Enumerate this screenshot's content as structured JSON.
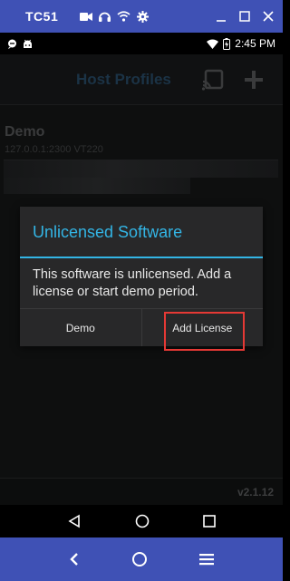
{
  "host": {
    "title": "TC51",
    "status_icons": [
      "video-camera-icon",
      "headphones-icon",
      "wifi-icon",
      "gear-icon"
    ],
    "window_controls": [
      "minimize-icon",
      "maximize-icon",
      "close-icon"
    ]
  },
  "status_bar": {
    "left_icons": [
      "chat-icon",
      "android-icon"
    ],
    "time": "2:45 PM",
    "right_icons": [
      "wifi-icon",
      "battery-icon"
    ]
  },
  "toolbar": {
    "title": "Host Profiles",
    "cast_icon": "cast-icon",
    "add_icon": "plus-icon"
  },
  "profile": {
    "name": "Demo",
    "detail": "127.0.0.1:2300  VT220"
  },
  "dialog": {
    "title": "Unlicensed Software",
    "message": "This software is unlicensed. Add a license or start demo period.",
    "demo_button": "Demo",
    "add_license_button": "Add License",
    "accent_color": "#33b5e5"
  },
  "footer": {
    "version": "v2.1.12"
  },
  "android_nav": [
    "back-icon",
    "home-icon",
    "recents-icon"
  ],
  "host_nav": [
    "chevron-left-icon",
    "circle-home-icon",
    "menu-icon"
  ],
  "colors": {
    "host_bar": "#3f51b5",
    "highlight": "#e53935"
  }
}
